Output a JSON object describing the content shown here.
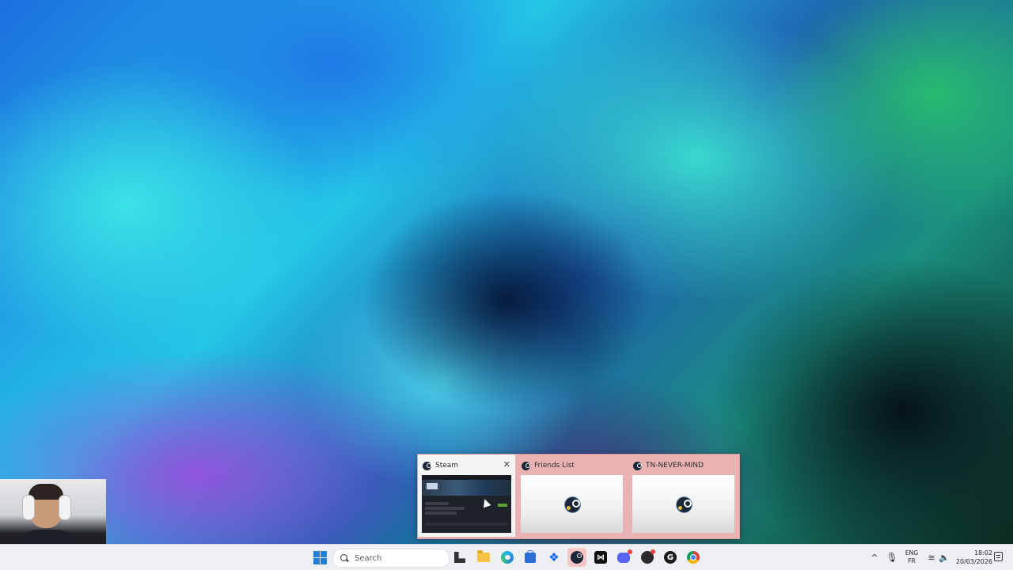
{
  "desktop": {
    "wallpaper_icon": "smoke-wallpaper",
    "colors": {
      "cyan": "#24c6e6",
      "blue": "#1c6fe0",
      "green": "#28be6e",
      "purple": "#9650dc"
    }
  },
  "webcam": {
    "icon": "webcam-overlay"
  },
  "thumbnail_preview": {
    "windows": [
      {
        "title": "Steam",
        "icon": "steam-icon",
        "close_label": "✕",
        "state": "hovered"
      },
      {
        "title": "Friends List",
        "icon": "steam-icon"
      },
      {
        "title": "TN-NEVER-MIND",
        "icon": "steam-icon"
      }
    ],
    "highlight_color": "#e9b3b3"
  },
  "taskbar": {
    "start_icon": "windows-start-icon",
    "search": {
      "placeholder": "Search"
    },
    "apps": [
      {
        "name": "File manager",
        "icon": "files-icon"
      },
      {
        "name": "File Explorer",
        "icon": "folder-icon"
      },
      {
        "name": "Microsoft Edge",
        "icon": "edge-icon"
      },
      {
        "name": "Microsoft Store",
        "icon": "store-icon"
      },
      {
        "name": "Dropbox",
        "icon": "dropbox-icon"
      },
      {
        "name": "Steam",
        "icon": "steam-icon",
        "active": true
      },
      {
        "name": "CapCut",
        "icon": "capcut-icon"
      },
      {
        "name": "Discord",
        "icon": "discord-icon"
      },
      {
        "name": "OBS",
        "icon": "obs-icon"
      },
      {
        "name": "G Hub",
        "icon": "g-icon"
      },
      {
        "name": "Google Chrome",
        "icon": "chrome-icon"
      }
    ],
    "tray": {
      "chevron": "^",
      "language_line1": "ENG",
      "language_line2": "FR",
      "time": "18:02",
      "date": "20/03/2026"
    }
  }
}
